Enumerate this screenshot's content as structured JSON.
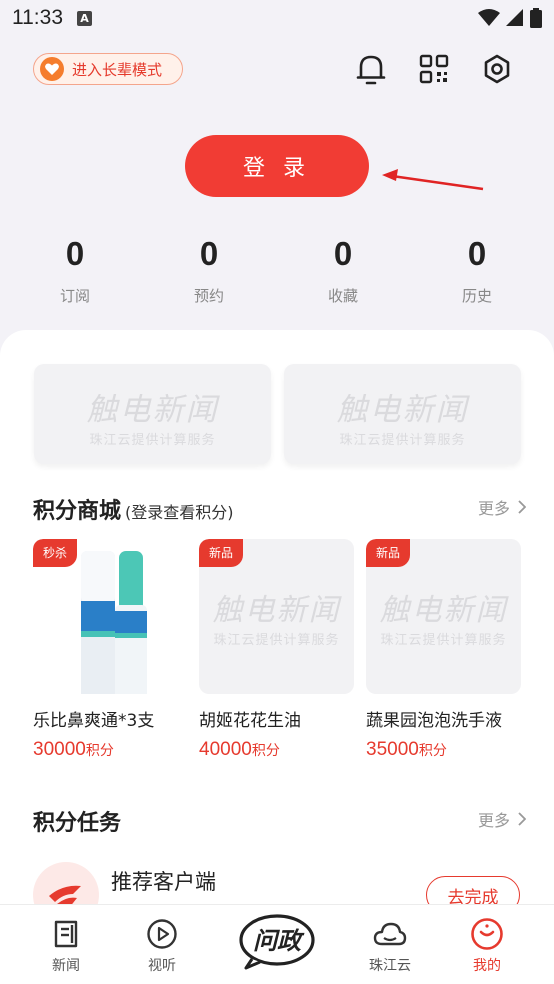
{
  "status_bar": {
    "time": "11:33",
    "sim_label": "A"
  },
  "header": {
    "elder_mode_label": "进入长辈模式",
    "icons": [
      "bell-icon",
      "qr-code-icon",
      "settings-icon"
    ]
  },
  "login": {
    "button_label": "登 录"
  },
  "stats": [
    {
      "value": "0",
      "label": "订阅"
    },
    {
      "value": "0",
      "label": "预约"
    },
    {
      "value": "0",
      "label": "收藏"
    },
    {
      "value": "0",
      "label": "历史"
    }
  ],
  "placeholder": {
    "title": "触电新闻",
    "subtitle": "珠江云提供计算服务"
  },
  "points_mall": {
    "title": "积分商城",
    "hint": "(登录查看积分)",
    "more_label": "更多",
    "products": [
      {
        "badge": "秒杀",
        "name": "乐比鼻爽通*3支",
        "price": "30000",
        "unit": "积分"
      },
      {
        "badge": "新品",
        "name": "胡姬花花生油",
        "price": "40000",
        "unit": "积分"
      },
      {
        "badge": "新品",
        "name": "蔬果园泡泡洗手液",
        "price": "35000",
        "unit": "积分"
      }
    ]
  },
  "points_tasks": {
    "title": "积分任务",
    "more_label": "更多",
    "task": {
      "title": "推荐客户端",
      "button_label": "去完成"
    }
  },
  "tabbar": {
    "tabs": [
      {
        "label": "新闻",
        "icon": "news-icon"
      },
      {
        "label": "视听",
        "icon": "play-icon"
      },
      {
        "label": "问政",
        "icon": "wenzheng-logo-icon"
      },
      {
        "label": "珠江云",
        "icon": "cloud-icon"
      },
      {
        "label": "我的",
        "icon": "profile-icon"
      }
    ],
    "center_label": "问政",
    "active_tab": "我的",
    "accent_color": "#e63a2e"
  }
}
